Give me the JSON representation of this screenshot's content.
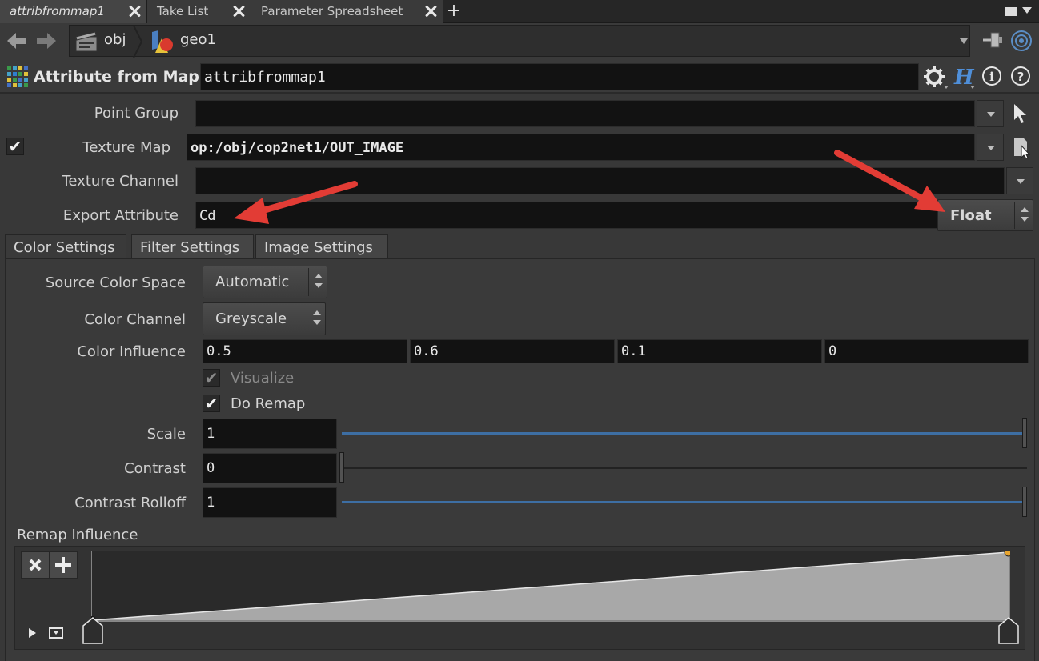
{
  "tabs": [
    {
      "label": "attribfrommap1",
      "active": true
    },
    {
      "label": "Take List",
      "active": false
    },
    {
      "label": "Parameter Spreadsheet",
      "active": false
    }
  ],
  "path": {
    "obj": "obj",
    "geo": "geo1"
  },
  "node": {
    "type_label": "Attribute from Map",
    "name": "attribfrommap1"
  },
  "params": {
    "point_group": {
      "label": "Point Group",
      "value": ""
    },
    "texture_map": {
      "label": "Texture Map",
      "value": "op:/obj/cop2net1/OUT_IMAGE",
      "enabled": true
    },
    "texture_channel": {
      "label": "Texture Channel",
      "value": ""
    },
    "export_attribute": {
      "label": "Export Attribute",
      "value": "Cd",
      "type": "Float"
    }
  },
  "folder_tabs": [
    "Color Settings",
    "Filter Settings",
    "Image Settings"
  ],
  "color_settings": {
    "source_color_space": {
      "label": "Source Color Space",
      "value": "Automatic"
    },
    "color_channel": {
      "label": "Color Channel",
      "value": "Greyscale"
    },
    "color_influence": {
      "label": "Color Influence",
      "values": [
        "0.5",
        "0.6",
        "0.1",
        "0"
      ]
    },
    "visualize": {
      "label": "Visualize",
      "checked": true,
      "enabled": false
    },
    "do_remap": {
      "label": "Do Remap",
      "checked": true
    },
    "scale": {
      "label": "Scale",
      "value": "1",
      "fraction": 1.0
    },
    "contrast": {
      "label": "Contrast",
      "value": "0",
      "fraction": 0.0
    },
    "contrast_rolloff": {
      "label": "Contrast Rolloff",
      "value": "1",
      "fraction": 1.0
    },
    "remap_influence": {
      "label": "Remap Influence"
    }
  },
  "colors": {
    "accent_blue": "#3d6ea3",
    "annotation_red": "#e23c35",
    "ramp_point": "#e8a530"
  }
}
